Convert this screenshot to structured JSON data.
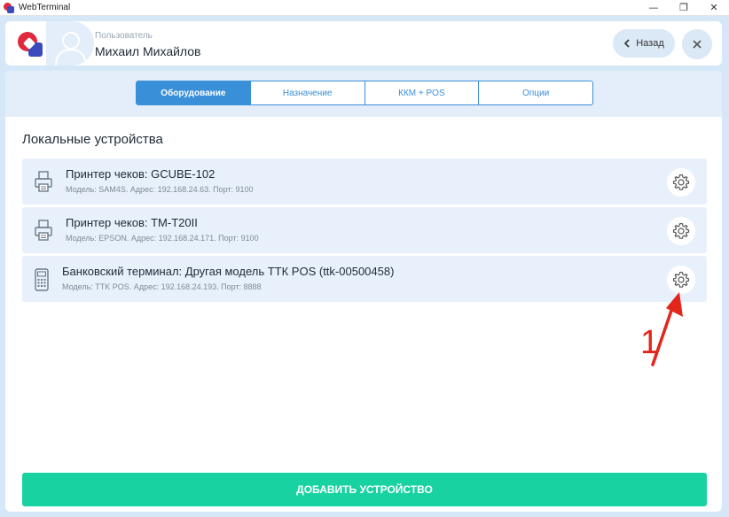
{
  "window": {
    "title": "WebTerminal",
    "controls": {
      "minimize": "—",
      "maximize": "❐",
      "close": "✕"
    }
  },
  "header": {
    "user_label": "Пользователь",
    "user_name": "Михаил Михайлов",
    "back_label": "Назад"
  },
  "tabs": [
    {
      "label": "Оборудование",
      "active": true
    },
    {
      "label": "Назначение",
      "active": false
    },
    {
      "label": "ККМ + POS",
      "active": false
    },
    {
      "label": "Опции",
      "active": false
    }
  ],
  "section_title": "Локальные устройства",
  "devices": [
    {
      "title": "Принтер чеков: GCUBE-102",
      "details": "Модель: SAM4S. Адрес: 192.168.24.63. Порт: 9100",
      "icon": "printer-icon"
    },
    {
      "title": "Принтер чеков: TM-T20II",
      "details": "Модель: EPSON. Адрес: 192.168.24.171. Порт: 9100",
      "icon": "printer-icon"
    },
    {
      "title": "Банковский терминал: Другая модель ТТК POS (ttk-00500458)",
      "details": "Модель: TTK POS. Адрес: 192.168.24.193. Порт: 8888",
      "icon": "terminal-icon"
    }
  ],
  "annotation": {
    "number": "1",
    "color": "#e3261c"
  },
  "add_button_label": "ДОБАВИТЬ УСТРОЙСТВО",
  "colors": {
    "accent": "#3a8fd9",
    "add_button": "#18d3a1",
    "background": "#d6e8f7"
  }
}
